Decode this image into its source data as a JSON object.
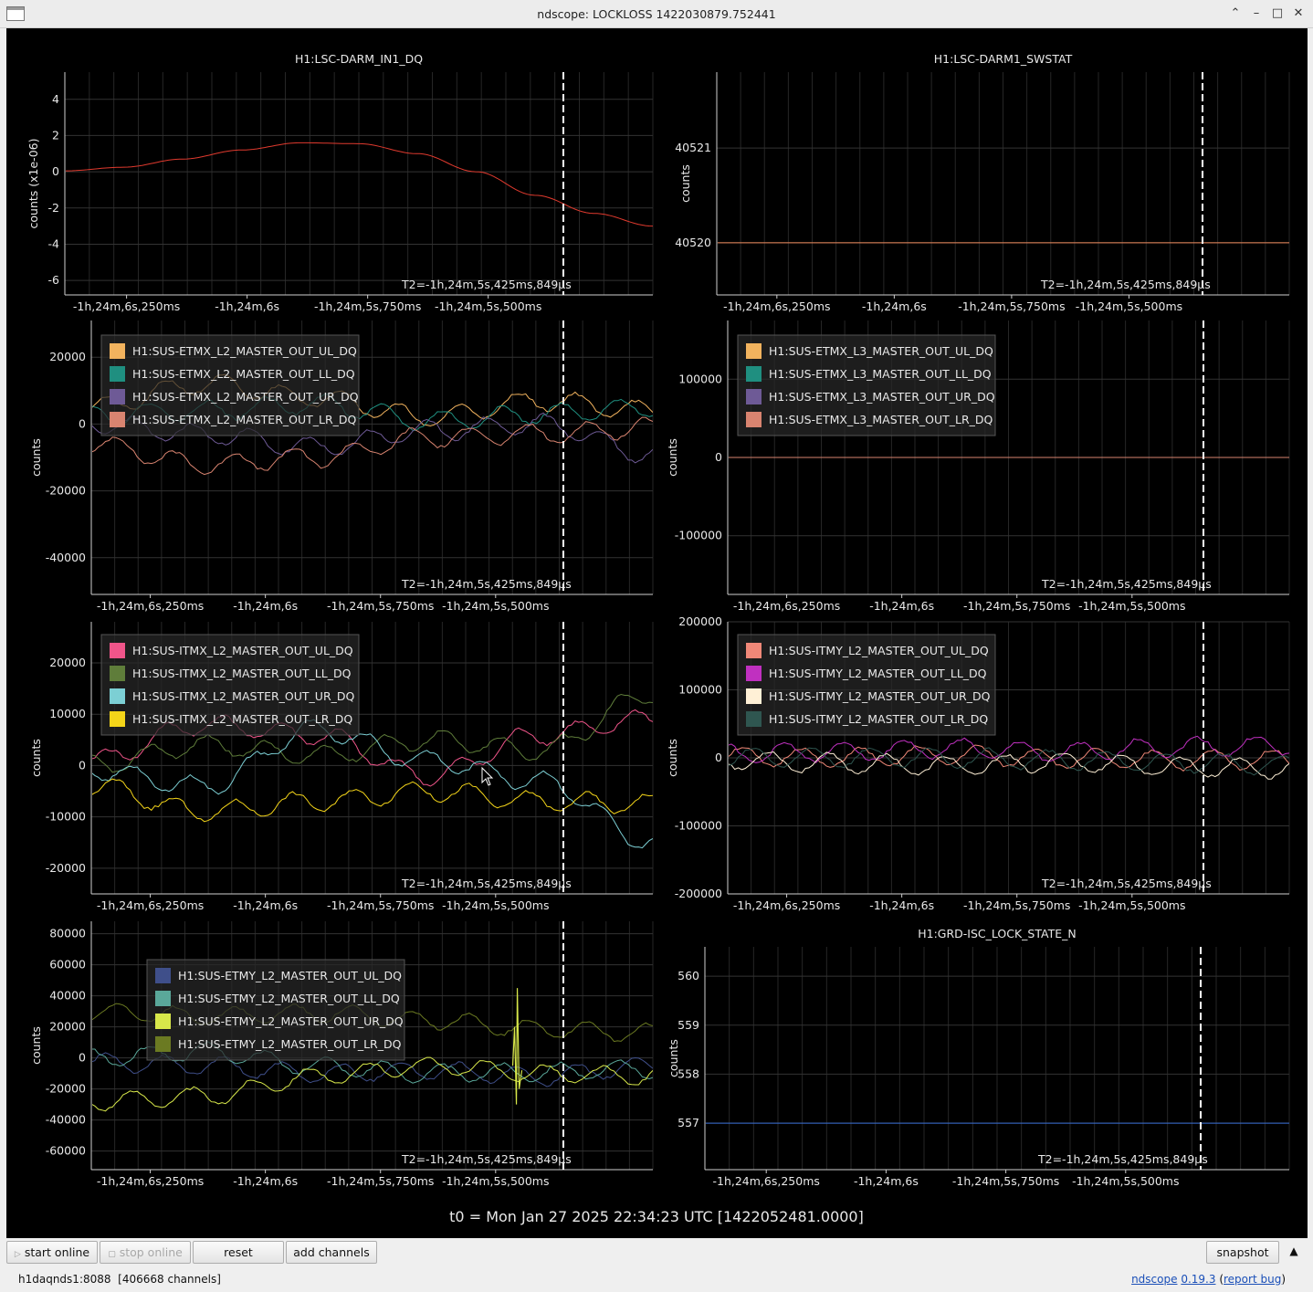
{
  "window": {
    "title": "ndscope: LOCKLOSS 1422030879.752441"
  },
  "t0_text": "t0 = Mon Jan 27 2025 22:34:23 UTC [1422052481.0000]",
  "cursor_label": "T2=-1h,24m,5s,425ms,849µs",
  "x_ticks": [
    "-1h,24m,6s,250ms",
    "-1h,24m,6s",
    "-1h,24m,5s,750ms",
    "-1h,24m,5s,500ms"
  ],
  "toolbar": {
    "start_online": "start online",
    "stop_online": "stop online",
    "reset": "reset",
    "add_channels": "add channels",
    "snapshot": "snapshot"
  },
  "status": {
    "server": "h1daqnds1:8088",
    "channels": "[406668 channels]",
    "app_name": "ndscope",
    "version": "0.19.3",
    "report_bug": "report bug"
  },
  "chart_data": [
    {
      "id": "darm_in1",
      "type": "line",
      "title": "H1:LSC-DARM_IN1_DQ",
      "ylabel": "counts (x1e-06)",
      "ylim": [
        -6.8,
        5.5
      ],
      "yticks": [
        4,
        2,
        0,
        -2,
        -4,
        -6
      ],
      "series": [
        {
          "color": "#e03a2e",
          "x": [
            0,
            0.1,
            0.2,
            0.3,
            0.4,
            0.5,
            0.6,
            0.7,
            0.8,
            0.9,
            1.0
          ],
          "y": [
            0.05,
            0.25,
            0.7,
            1.2,
            1.6,
            1.55,
            1.0,
            0.0,
            -1.3,
            -2.3,
            -3.0
          ]
        }
      ]
    },
    {
      "id": "darm1_swstat",
      "type": "line",
      "title": "H1:LSC-DARM1_SWSTAT",
      "ylabel": "counts",
      "ylim": [
        40519.45,
        40521.8
      ],
      "yticks": [
        40521,
        40520
      ],
      "series": [
        {
          "color": "#f08a5d",
          "x": [
            0,
            1
          ],
          "y": [
            40520,
            40520
          ]
        }
      ]
    },
    {
      "id": "etmx_l2",
      "type": "line",
      "title": "",
      "ylabel": "counts",
      "ylim": [
        -51000,
        31000
      ],
      "yticks": [
        20000,
        0,
        -20000,
        -40000
      ],
      "legend": [
        "H1:SUS-ETMX_L2_MASTER_OUT_UL_DQ",
        "H1:SUS-ETMX_L2_MASTER_OUT_LL_DQ",
        "H1:SUS-ETMX_L2_MASTER_OUT_UR_DQ",
        "H1:SUS-ETMX_L2_MASTER_OUT_LR_DQ"
      ],
      "series": [
        {
          "name": "H1:SUS-ETMX_L2_MASTER_OUT_UL_DQ",
          "color": "#f2b35e",
          "x": [
            0,
            0.2,
            0.4,
            0.6,
            0.8,
            1.0
          ],
          "y": [
            5000,
            12000,
            8000,
            2000,
            7000,
            4000
          ]
        },
        {
          "name": "H1:SUS-ETMX_L2_MASTER_OUT_LL_DQ",
          "color": "#1f8f80",
          "x": [
            0,
            0.2,
            0.4,
            0.6,
            0.8,
            1.0
          ],
          "y": [
            3000,
            4000,
            6000,
            1000,
            3000,
            5000
          ]
        },
        {
          "name": "H1:SUS-ETMX_L2_MASTER_OUT_UR_DQ",
          "color": "#6e5a96",
          "x": [
            0,
            0.2,
            0.4,
            0.6,
            0.8,
            1.0
          ],
          "y": [
            0,
            -3000,
            -7000,
            -2000,
            0,
            -9000
          ]
        },
        {
          "name": "H1:SUS-ETMX_L2_MASTER_OUT_LR_DQ",
          "color": "#d98470",
          "x": [
            0,
            0.2,
            0.4,
            0.6,
            0.8,
            1.0
          ],
          "y": [
            -6000,
            -12000,
            -10000,
            -4000,
            -3000,
            -1000
          ]
        }
      ]
    },
    {
      "id": "etmx_l3",
      "type": "line",
      "title": "",
      "ylabel": "counts",
      "ylim": [
        -175000,
        175000
      ],
      "yticks": [
        100000,
        0,
        -100000
      ],
      "legend": [
        "H1:SUS-ETMX_L3_MASTER_OUT_UL_DQ",
        "H1:SUS-ETMX_L3_MASTER_OUT_LL_DQ",
        "H1:SUS-ETMX_L3_MASTER_OUT_UR_DQ",
        "H1:SUS-ETMX_L3_MASTER_OUT_LR_DQ"
      ],
      "series": [
        {
          "name": "H1:SUS-ETMX_L3_MASTER_OUT_LR_DQ",
          "color": "#d98470",
          "x": [
            0,
            1
          ],
          "y": [
            0,
            0
          ]
        }
      ]
    },
    {
      "id": "itmx_l2",
      "type": "line",
      "title": "",
      "ylabel": "counts",
      "ylim": [
        -25000,
        28000
      ],
      "yticks": [
        20000,
        10000,
        0,
        -10000,
        -20000
      ],
      "legend": [
        "H1:SUS-ITMX_L2_MASTER_OUT_UL_DQ",
        "H1:SUS-ITMX_L2_MASTER_OUT_LL_DQ",
        "H1:SUS-ITMX_L2_MASTER_OUT_UR_DQ",
        "H1:SUS-ITMX_L2_MASTER_OUT_LR_DQ"
      ],
      "series": [
        {
          "name": "H1:SUS-ITMX_L2_MASTER_OUT_UL_DQ",
          "color": "#f0558a",
          "x": [
            0,
            0.2,
            0.4,
            0.6,
            0.8,
            1.0
          ],
          "y": [
            1000,
            8000,
            6000,
            -2000,
            6000,
            9000
          ]
        },
        {
          "name": "H1:SUS-ITMX_L2_MASTER_OUT_LL_DQ",
          "color": "#5f7d3a",
          "x": [
            0,
            0.2,
            0.4,
            0.6,
            0.8,
            1.0
          ],
          "y": [
            0,
            4000,
            2000,
            5000,
            3000,
            14000
          ]
        },
        {
          "name": "H1:SUS-ITMX_L2_MASTER_OUT_UR_DQ",
          "color": "#7ccfd4",
          "x": [
            0,
            0.2,
            0.4,
            0.6,
            0.8,
            1.0
          ],
          "y": [
            -1000,
            -4000,
            7000,
            1000,
            -3000,
            -15000
          ]
        },
        {
          "name": "H1:SUS-ITMX_L2_MASTER_OUT_LR_DQ",
          "color": "#f4d519",
          "x": [
            0,
            0.2,
            0.4,
            0.6,
            0.8,
            1.0
          ],
          "y": [
            -4000,
            -9000,
            -7000,
            -5000,
            -7000,
            -7500
          ]
        }
      ]
    },
    {
      "id": "itmy_l2",
      "type": "line",
      "title": "",
      "ylabel": "counts",
      "ylim": [
        -200000,
        200000
      ],
      "yticks": [
        200000,
        100000,
        0,
        -100000,
        -200000
      ],
      "legend": [
        "H1:SUS-ITMY_L2_MASTER_OUT_UL_DQ",
        "H1:SUS-ITMY_L2_MASTER_OUT_LL_DQ",
        "H1:SUS-ITMY_L2_MASTER_OUT_UR_DQ",
        "H1:SUS-ITMY_L2_MASTER_OUT_LR_DQ"
      ],
      "series": [
        {
          "name": "H1:SUS-ITMY_L2_MASTER_OUT_UL_DQ",
          "color": "#f08878",
          "x": [
            0,
            0.2,
            0.4,
            0.6,
            0.8,
            1.0
          ],
          "y": [
            2000,
            0,
            4000,
            -1000,
            -3000,
            -2000
          ]
        },
        {
          "name": "H1:SUS-ITMY_L2_MASTER_OUT_LL_DQ",
          "color": "#c030c0",
          "x": [
            0,
            0.2,
            0.4,
            0.6,
            0.8,
            1.0
          ],
          "y": [
            6000,
            9000,
            14000,
            8000,
            16000,
            18000
          ]
        },
        {
          "name": "H1:SUS-ITMY_L2_MASTER_OUT_UR_DQ",
          "color": "#fff0d6",
          "x": [
            0,
            0.2,
            0.4,
            0.6,
            0.8,
            1.0
          ],
          "y": [
            -3000,
            -8000,
            -12000,
            -6000,
            -13000,
            -16000
          ]
        },
        {
          "name": "H1:SUS-ITMY_L2_MASTER_OUT_LR_DQ",
          "color": "#2f5650",
          "x": [
            0,
            0.2,
            0.4,
            0.6,
            0.8,
            1.0
          ],
          "y": [
            0,
            1000,
            -1000,
            -3000,
            -7000,
            -10000
          ]
        }
      ]
    },
    {
      "id": "etmy_l2",
      "type": "line",
      "title": "",
      "ylabel": "counts",
      "ylim": [
        -72000,
        88000
      ],
      "yticks": [
        80000,
        60000,
        40000,
        20000,
        0,
        -20000,
        -40000,
        -60000
      ],
      "legend": [
        "H1:SUS-ETMY_L2_MASTER_OUT_UL_DQ",
        "H1:SUS-ETMY_L2_MASTER_OUT_LL_DQ",
        "H1:SUS-ETMY_L2_MASTER_OUT_UR_DQ",
        "H1:SUS-ETMY_L2_MASTER_OUT_LR_DQ"
      ],
      "series": [
        {
          "name": "H1:SUS-ETMY_L2_MASTER_OUT_UL_DQ",
          "color": "#3f4f8a",
          "x": [
            0,
            0.2,
            0.4,
            0.6,
            0.8,
            1.0
          ],
          "y": [
            -3000,
            -5000,
            -10000,
            -8000,
            -12000,
            -5000
          ]
        },
        {
          "name": "H1:SUS-ETMY_L2_MASTER_OUT_LL_DQ",
          "color": "#5aa89a",
          "x": [
            0,
            0.2,
            0.4,
            0.6,
            0.8,
            1.0
          ],
          "y": [
            0,
            4000,
            -5000,
            -10000,
            -9000,
            -7000
          ]
        },
        {
          "name": "H1:SUS-ETMY_L2_MASTER_OUT_UR_DQ",
          "color": "#d8e84a",
          "x": [
            0,
            0.2,
            0.4,
            0.6,
            0.8,
            1.0
          ],
          "y": [
            -28000,
            -25000,
            -12000,
            -5000,
            -10000,
            -12000
          ]
        },
        {
          "name": "H1:SUS-ETMY_L2_MASTER_OUT_LR_DQ",
          "color": "#6b7a22",
          "x": [
            0,
            0.2,
            0.4,
            0.6,
            0.8,
            1.0
          ],
          "y": [
            30000,
            27000,
            29000,
            24000,
            19000,
            16000
          ]
        }
      ]
    },
    {
      "id": "isc_lock_state",
      "type": "line",
      "title": "H1:GRD-ISC_LOCK_STATE_N",
      "ylabel": "counts",
      "ylim": [
        556.05,
        560.6
      ],
      "yticks": [
        560,
        559,
        558,
        557
      ],
      "series": [
        {
          "color": "#3a6fd8",
          "x": [
            0,
            1
          ],
          "y": [
            557,
            557
          ]
        }
      ]
    }
  ]
}
